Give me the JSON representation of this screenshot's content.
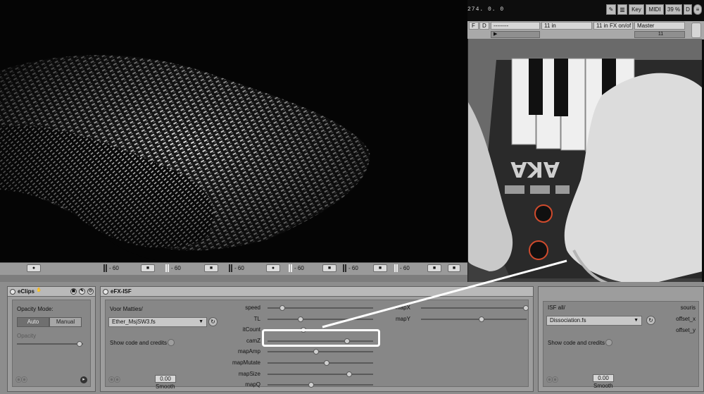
{
  "colors": {
    "background": "#0b0b0b",
    "panel": "#9d9d9d",
    "highlight": "#ffffff",
    "manual_active": "#6f6f6f"
  },
  "top_bar": {
    "transport_readout": "274. 0. 0",
    "key_label": "Key",
    "midi_label": "MIDI",
    "zoom_value": "39 %",
    "d_label": "D"
  },
  "mixer": {
    "f_label": "F",
    "d_label": "D",
    "track_dashes": "--------",
    "input_1": "11 in",
    "input_2": "11 in FX on/of",
    "master": "Master",
    "master_value": "11"
  },
  "track_strip": {
    "volume_label": "- 60",
    "slot_icons": [
      "record-icon",
      "stop-icon",
      "stop-icon",
      "record-icon",
      "stop-icon",
      "stop-icon",
      "stop-icon"
    ]
  },
  "eclips": {
    "title": "eClips",
    "opacity_mode_label": "Opacity Mode:",
    "auto_label": "Auto",
    "manual_label": "Manual",
    "opacity_label": "Opacity",
    "opacity_value": 0.95
  },
  "efx_isf": {
    "title": "eFX-ISF",
    "folder": "Voor Matties/",
    "shader": "Ether_MsjSW3.fs",
    "show_code_label": "Show code and credits",
    "smooth_value": "0.00",
    "smooth_label": "Smooth",
    "params": [
      {
        "name": "speed",
        "value": 0.14
      },
      {
        "name": "TL",
        "value": 0.31
      },
      {
        "name": "itCount",
        "value": 0.34
      },
      {
        "name": "camZ",
        "value": 0.75
      },
      {
        "name": "mapAmp",
        "value": 0.46
      },
      {
        "name": "mapMutate",
        "value": 0.56
      },
      {
        "name": "mapSize",
        "value": 0.77
      },
      {
        "name": "mapQ",
        "value": 0.41
      }
    ],
    "right_params": [
      {
        "name": "mapX",
        "value": 0.99
      },
      {
        "name": "mapY",
        "value": 0.57
      }
    ]
  },
  "isf_all": {
    "folder": "ISF all/",
    "shader": "Dissociation.fs",
    "show_code_label": "Show code and credits",
    "smooth_value": "0.00",
    "smooth_label": "Smooth",
    "params": [
      "souris",
      "offset_x",
      "offset_y"
    ]
  }
}
